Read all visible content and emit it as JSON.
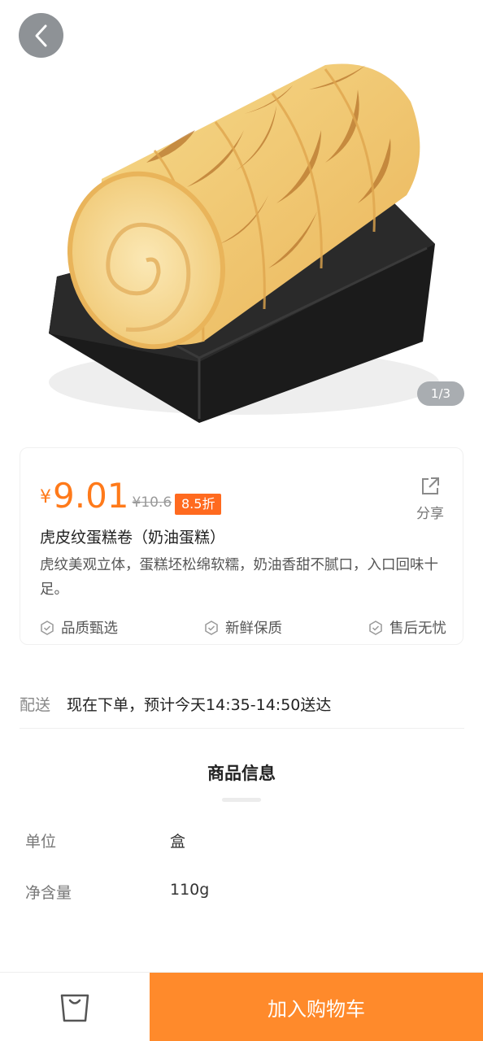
{
  "gallery": {
    "image_alt": "虎皮纹蛋糕卷",
    "indicator": "1/3"
  },
  "product": {
    "currency": "¥",
    "price": "9.01",
    "original_price": "¥10.6",
    "discount": "8.5折",
    "share_label": "分享",
    "title": "虎皮纹蛋糕卷（奶油蛋糕）",
    "description": "虎纹美观立体，蛋糕坯松绵软糯，奶油香甜不腻口，入口回味十足。",
    "tags": [
      "品质甄选",
      "新鲜保质",
      "售后无忧"
    ]
  },
  "delivery": {
    "label": "配送",
    "text": "现在下单，预计今天14:35-14:50送达"
  },
  "product_info": {
    "title": "商品信息",
    "rows": [
      {
        "label": "单位",
        "value": "盒"
      },
      {
        "label": "净含量",
        "value": "110g"
      }
    ]
  },
  "bottom_bar": {
    "add_to_cart_label": "加入购物车"
  },
  "colors": {
    "accent": "#ff7a1a",
    "button": "#ff8a2b",
    "discount_badge": "#ff6a1f"
  }
}
